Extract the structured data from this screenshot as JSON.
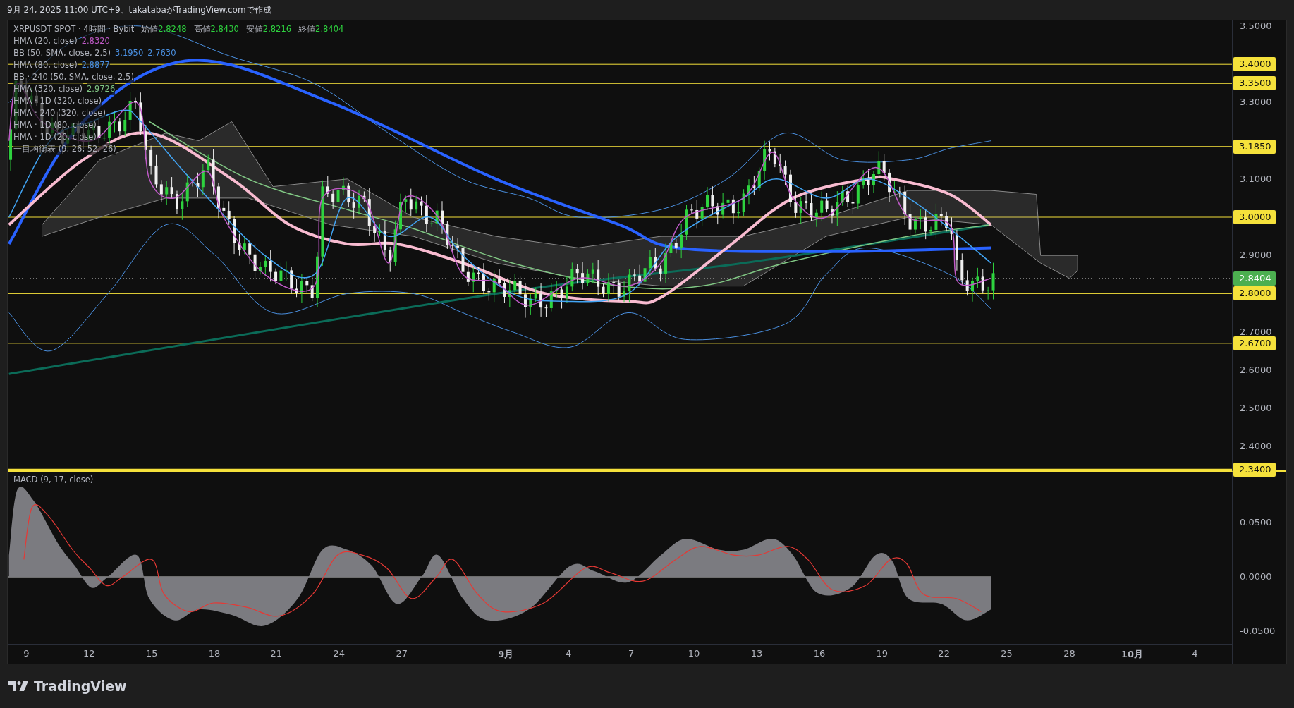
{
  "header": {
    "text": "9月 24, 2025 11:00 UTC+9、takatabaがTradingView.comで作成"
  },
  "legend": {
    "symbol": "XRPUSDT SPOT · 4時間 · Bybit",
    "ohlc": [
      {
        "label": "始値",
        "value": "2.8248"
      },
      {
        "label": "高値",
        "value": "2.8430"
      },
      {
        "label": "安値",
        "value": "2.8216"
      },
      {
        "label": "終値",
        "value": "2.8404"
      }
    ],
    "indicators": [
      {
        "name": "HMA (20, close)",
        "values": [
          {
            "text": "2.8320",
            "color": "#c05ac8"
          }
        ]
      },
      {
        "name": "BB (50, SMA, close, 2.5)",
        "values": [
          {
            "text": "3.1950",
            "color": "#4a8fe0"
          },
          {
            "text": "2.7630",
            "color": "#4a8fe0"
          }
        ]
      },
      {
        "name": "HMA (80, close)",
        "values": [
          {
            "text": "2.8877",
            "color": "#4a8fe0"
          }
        ]
      },
      {
        "name": "BB · 240 (50, SMA, close, 2.5)"
      },
      {
        "name": "HMA (320, close)",
        "values": [
          {
            "text": "2.9726",
            "color": "#81c784"
          }
        ]
      },
      {
        "name": "HMA · 1D (320, close)"
      },
      {
        "name": "HMA · 240 (320, close)"
      },
      {
        "name": "HMA · 1D (80, close)"
      },
      {
        "name": "HMA · 1D (20, close)"
      },
      {
        "name": "一目均衡表 (9, 26, 52, 26)"
      }
    ]
  },
  "price_axis": {
    "ticks": [
      "3.5000",
      "3.3000",
      "3.1000",
      "2.9000",
      "2.7000",
      "2.6000",
      "2.5000",
      "2.4000"
    ],
    "levels": [
      "3.4000",
      "3.3500",
      "3.1850",
      "3.0000",
      "2.8000",
      "2.6700",
      "2.3400"
    ],
    "last_price": "2.8404"
  },
  "macd": {
    "title": "MACD (9, 17, close)",
    "ticks": [
      "0.0500",
      "0.0000",
      "-0.0500"
    ]
  },
  "time_axis": [
    {
      "label": "9",
      "kind": "day"
    },
    {
      "label": "12",
      "kind": "day"
    },
    {
      "label": "15",
      "kind": "day"
    },
    {
      "label": "18",
      "kind": "day"
    },
    {
      "label": "21",
      "kind": "day"
    },
    {
      "label": "24",
      "kind": "day"
    },
    {
      "label": "27",
      "kind": "day"
    },
    {
      "label": "9月",
      "kind": "month"
    },
    {
      "label": "4",
      "kind": "day"
    },
    {
      "label": "7",
      "kind": "day"
    },
    {
      "label": "10",
      "kind": "day"
    },
    {
      "label": "13",
      "kind": "day"
    },
    {
      "label": "16",
      "kind": "day"
    },
    {
      "label": "19",
      "kind": "day"
    },
    {
      "label": "22",
      "kind": "day"
    },
    {
      "label": "25",
      "kind": "day"
    },
    {
      "label": "28",
      "kind": "day"
    },
    {
      "label": "10月",
      "kind": "month"
    },
    {
      "label": "4",
      "kind": "day"
    }
  ],
  "footer": {
    "brand": "TradingView"
  }
}
